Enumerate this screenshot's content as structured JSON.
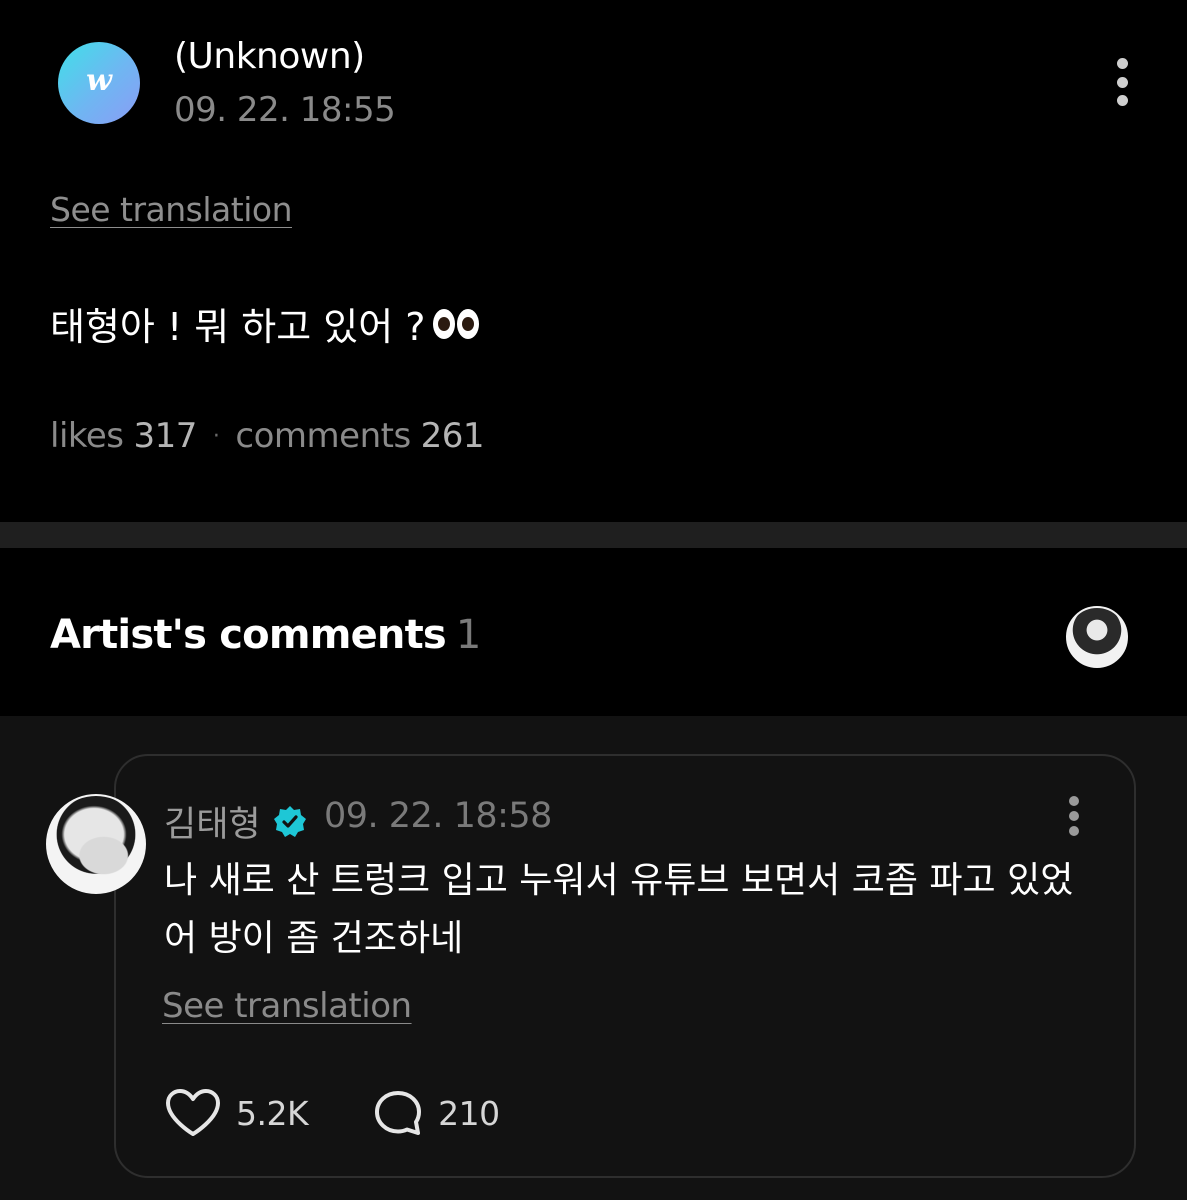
{
  "post": {
    "avatar_letter": "w",
    "author": "(Unknown)",
    "timestamp": "09. 22. 18:55",
    "see_translation": "See translation",
    "body": "태형아 ! 뭐 하고 있어 ?",
    "body_emoji": "eyes",
    "stats": {
      "likes_label": "likes",
      "likes_count": "317",
      "separator": "·",
      "comments_label": "comments",
      "comments_count": "261"
    }
  },
  "artist_comments": {
    "title": "Artist's comments",
    "count": "1"
  },
  "comment": {
    "author": "김태형",
    "verified": true,
    "timestamp": "09. 22. 18:58",
    "text": "나 새로 산 트렁크 입고 누워서 유튜브 보면서 코좀 파고 있었어 방이 좀 건조하네",
    "see_translation": "See translation",
    "likes": "5.2K",
    "replies": "210"
  },
  "colors": {
    "background": "#000000",
    "divider": "#1f1f1f",
    "comment_area": "#121212",
    "verified_badge": "#1ec7d6",
    "muted_text": "#8a8a8a"
  }
}
